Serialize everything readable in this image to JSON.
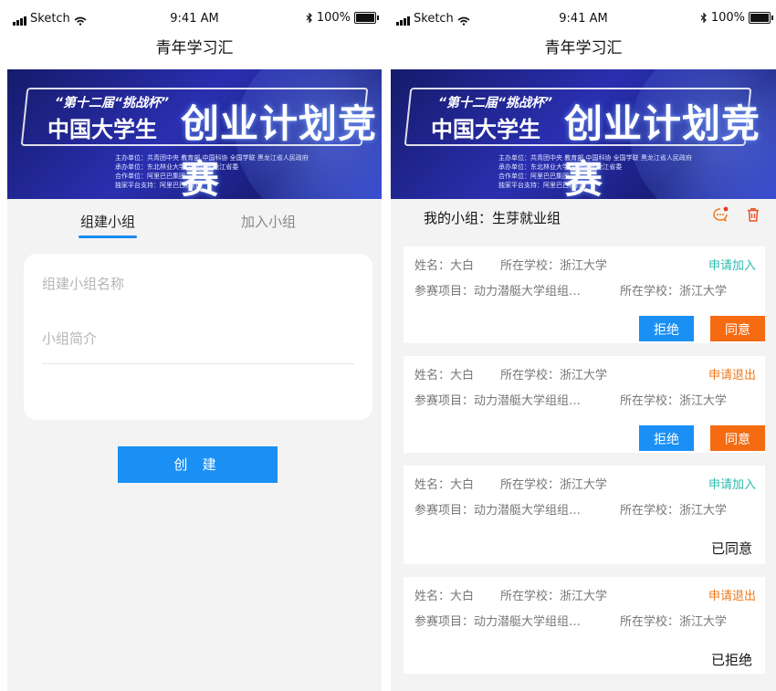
{
  "status_bar": {
    "carrier": "Sketch",
    "time": "9:41 AM",
    "battery": "100%"
  },
  "app": {
    "title": "青年学习汇"
  },
  "banner": {
    "line1": "“第十二届“挑战杯”",
    "line2": "中国大学生",
    "line3": "创业计划竞赛",
    "info": [
      "主办单位：共青团中央 教育部 中国科协 全国学联 黑龙江省人民政府",
      "承办单位：东北林业大学 共青团黑龙江省委",
      "合作单位：阿里巴巴集团",
      "独家平台支持：阿里巴巴钉钉"
    ]
  },
  "left": {
    "tabs": {
      "create": "组建小组",
      "join": "加入小组"
    },
    "form": {
      "group_name_placeholder": "组建小组名称",
      "group_intro_placeholder": "小组简介"
    },
    "create_button": "创 建"
  },
  "right": {
    "group_title": "我的小组：生芽就业组",
    "requests": [
      {
        "name": "姓名：大白",
        "school": "所在学校：浙江大学",
        "status": "申请加入",
        "status_type": "join",
        "project": "参赛项目：动力潜艇大学组组…",
        "school2": "所在学校：浙江大学",
        "reject": "拒绝",
        "agree": "同意",
        "result": ""
      },
      {
        "name": "姓名：大白",
        "school": "所在学校：浙江大学",
        "status": "申请退出",
        "status_type": "exit",
        "project": "参赛项目：动力潜艇大学组组…",
        "school2": "所在学校：浙江大学",
        "reject": "拒绝",
        "agree": "同意",
        "result": ""
      },
      {
        "name": "姓名：大白",
        "school": "所在学校：浙江大学",
        "status": "申请加入",
        "status_type": "join",
        "project": "参赛项目：动力潜艇大学组组…",
        "school2": "所在学校：浙江大学",
        "reject": "",
        "agree": "",
        "result": "已同意"
      },
      {
        "name": "姓名：大白",
        "school": "所在学校：浙江大学",
        "status": "申请退出",
        "status_type": "exit",
        "project": "参赛项目：动力潜艇大学组组…",
        "school2": "所在学校：浙江大学",
        "reject": "",
        "agree": "",
        "result": "已拒绝"
      }
    ]
  },
  "colors": {
    "primary": "#1a90f5",
    "accent": "#f46b12",
    "join": "#2bbbb0",
    "background": "#f3f3f3"
  },
  "icons": {
    "chat": "chat-bubble-icon",
    "trash": "trash-icon"
  }
}
